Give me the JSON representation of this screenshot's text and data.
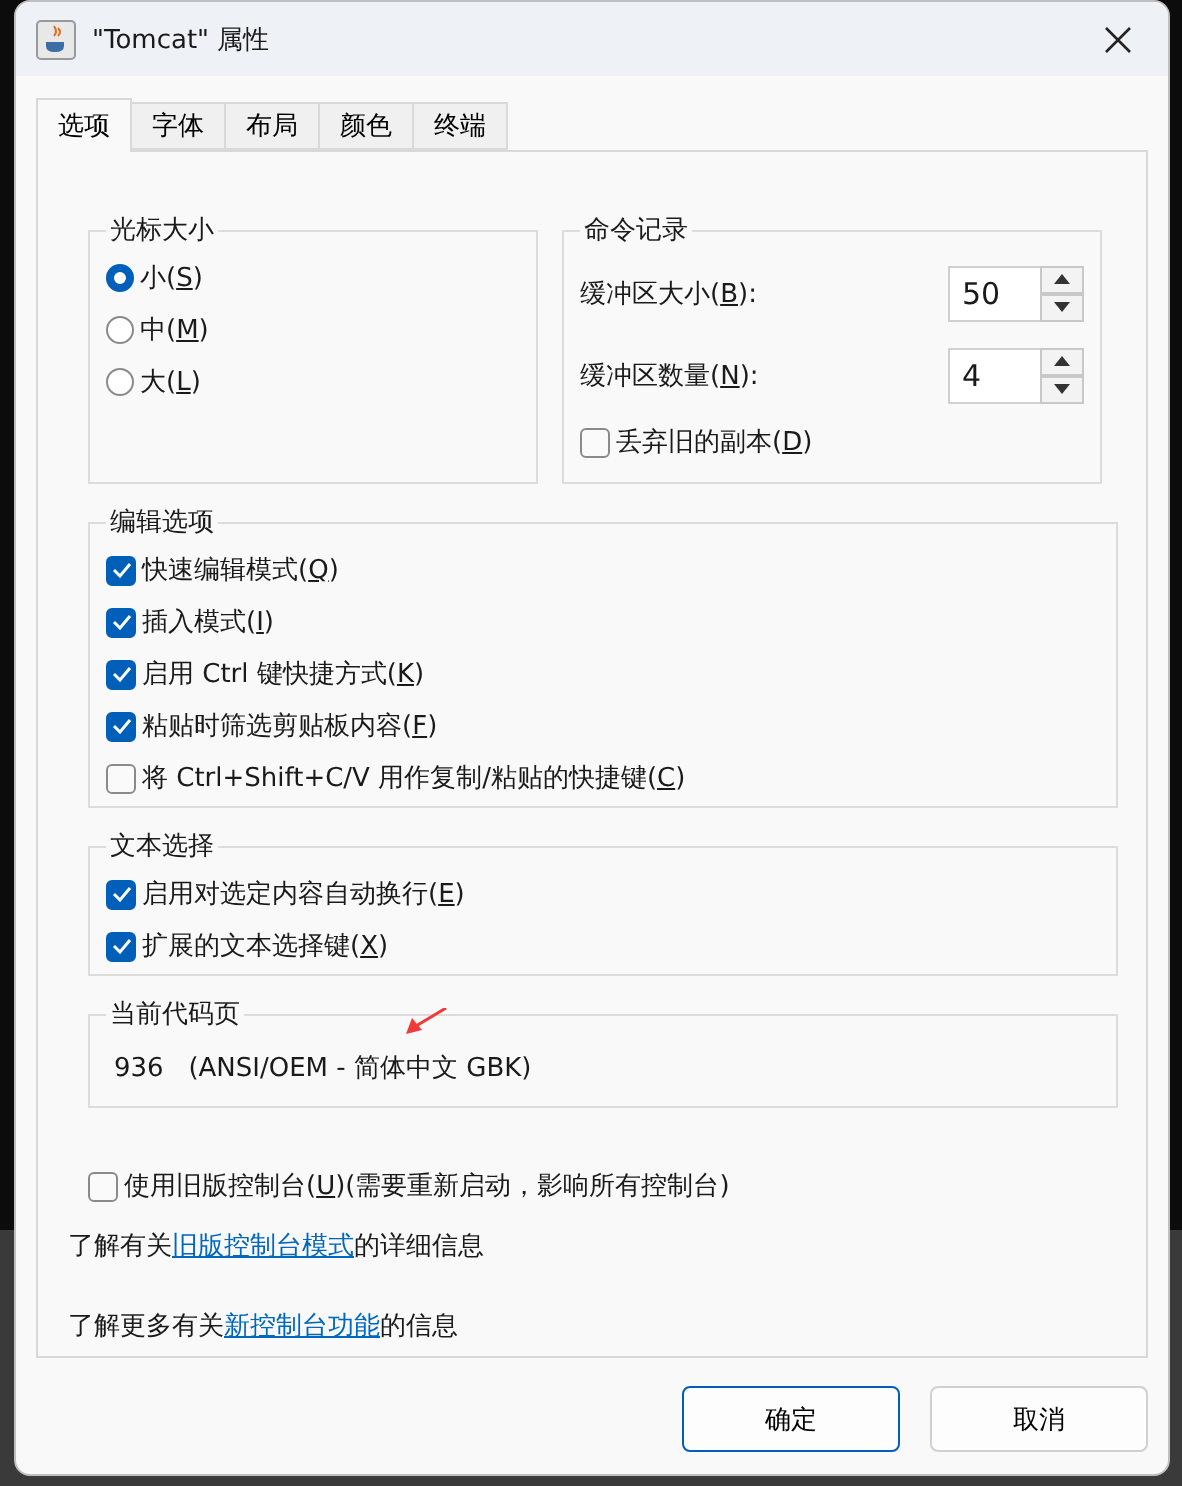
{
  "window": {
    "title": "\"Tomcat\" 属性"
  },
  "tabs": [
    {
      "label": "选项",
      "selected": true
    },
    {
      "label": "字体",
      "selected": false
    },
    {
      "label": "布局",
      "selected": false
    },
    {
      "label": "颜色",
      "selected": false
    },
    {
      "label": "终端",
      "selected": false
    }
  ],
  "cursor_size": {
    "title": "光标大小",
    "options": [
      {
        "label": [
          "小(",
          "S",
          ")"
        ],
        "selected": true
      },
      {
        "label": [
          "中(",
          "M",
          ")"
        ],
        "selected": false
      },
      {
        "label": [
          "大(",
          "L",
          ")"
        ],
        "selected": false
      }
    ]
  },
  "command_history": {
    "title": "命令记录",
    "fields": [
      {
        "label": [
          "缓冲区大小(",
          "B",
          "):"
        ],
        "value": "50"
      },
      {
        "label": [
          "缓冲区数量(",
          "N",
          "):"
        ],
        "value": "4"
      }
    ],
    "discard_old": {
      "label": [
        "丢弃旧的副本(",
        "D",
        ")"
      ],
      "checked": false
    }
  },
  "edit_options": {
    "title": "编辑选项",
    "items": [
      {
        "label": [
          "快速编辑模式(",
          "Q",
          ")"
        ],
        "checked": true
      },
      {
        "label": [
          "插入模式(",
          "I",
          ")"
        ],
        "checked": true
      },
      {
        "label": [
          "启用 Ctrl 键快捷方式(",
          "K",
          ")"
        ],
        "checked": true
      },
      {
        "label": [
          "粘贴时筛选剪贴板内容(",
          "F",
          ")"
        ],
        "checked": true
      },
      {
        "label": [
          "将 Ctrl+Shift+C/V 用作复制/粘贴的快捷键(",
          "C",
          ")"
        ],
        "checked": false
      }
    ]
  },
  "text_selection": {
    "title": "文本选择",
    "items": [
      {
        "label": [
          "启用对选定内容自动换行(",
          "E",
          ")"
        ],
        "checked": true
      },
      {
        "label": [
          "扩展的文本选择键(",
          "X",
          ")"
        ],
        "checked": true
      }
    ]
  },
  "code_page": {
    "title": "当前代码页",
    "number": "936",
    "description": "(ANSI/OEM - 简体中文 GBK)"
  },
  "legacy_console": {
    "label": [
      "使用旧版控制台(",
      "U",
      ")(需要重新启动，影响所有控制台)"
    ],
    "checked": false
  },
  "info_links": [
    {
      "before": "了解有关",
      "link": "旧版控制台模式",
      "after": "的详细信息"
    },
    {
      "before": "了解更多有关",
      "link": "新控制台功能",
      "after": "的信息"
    }
  ],
  "buttons": [
    {
      "label": "确定",
      "default": true
    },
    {
      "label": "取消",
      "default": false
    }
  ]
}
